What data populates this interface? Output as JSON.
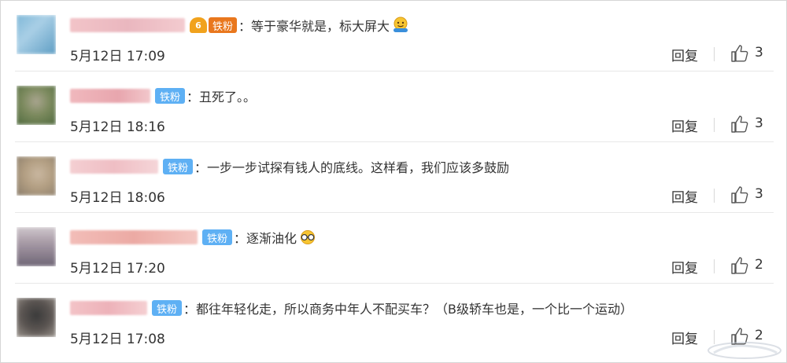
{
  "comments": [
    {
      "text": "等于豪华就是，标大屏大",
      "badge": "铁粉",
      "crown_glyph": "6",
      "time": "5月12日 17:09",
      "reply": "回复",
      "likes": "3",
      "emoji": "hug-emoji"
    },
    {
      "text": "丑死了。。",
      "badge": "铁粉",
      "time": "5月12日 18:16",
      "reply": "回复",
      "likes": "3"
    },
    {
      "text": "一步一步试探有钱人的底线。这样看，我们应该多鼓励",
      "badge": "铁粉",
      "time": "5月12日 18:06",
      "reply": "回复",
      "likes": "3"
    },
    {
      "text": "逐渐油化",
      "badge": "铁粉",
      "time": "5月12日 17:20",
      "reply": "回复",
      "likes": "2",
      "emoji": "glasses-emoji"
    },
    {
      "text": "都往年轻化走，所以商务中年人不配买车？（B级轿车也是，一个比一个运动）",
      "badge": "铁粉",
      "time": "5月12日 17:08",
      "reply": "回复",
      "likes": "2"
    }
  ],
  "colon": "：",
  "colors": {
    "badge_blue": "#5eb0f4",
    "crown_orange": "#f1a21d",
    "username_pink": "#f4c4c4",
    "separator": "#e8e8e8"
  }
}
